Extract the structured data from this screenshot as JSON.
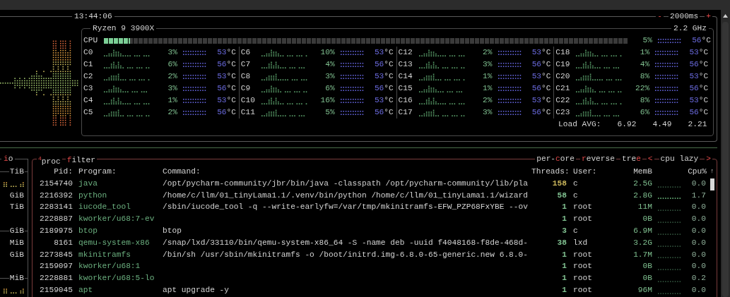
{
  "clock": "13:44:06",
  "interval": {
    "minus": "-",
    "value": "2000ms",
    "plus": "+"
  },
  "cpu": {
    "model": "Ryzen 9 3900X",
    "frequency": "2.2 GHz",
    "total": {
      "label": "CPU",
      "level": 0.05,
      "percent": "5%",
      "temp": "56",
      "temp_unit": "°C"
    },
    "cores": [
      {
        "name": "C0",
        "percent": "3%",
        "temp": "53",
        "temp_unit": "°C"
      },
      {
        "name": "C1",
        "percent": "6%",
        "temp": "56",
        "temp_unit": "°C"
      },
      {
        "name": "C2",
        "percent": "2%",
        "temp": "53",
        "temp_unit": "°C"
      },
      {
        "name": "C3",
        "percent": "3%",
        "temp": "56",
        "temp_unit": "°C"
      },
      {
        "name": "C4",
        "percent": "1%",
        "temp": "53",
        "temp_unit": "°C"
      },
      {
        "name": "C5",
        "percent": "2%",
        "temp": "56",
        "temp_unit": "°C"
      },
      {
        "name": "C6",
        "percent": "10%",
        "temp": "53",
        "temp_unit": "°C"
      },
      {
        "name": "C7",
        "percent": "4%",
        "temp": "56",
        "temp_unit": "°C"
      },
      {
        "name": "C8",
        "percent": "3%",
        "temp": "53",
        "temp_unit": "°C"
      },
      {
        "name": "C9",
        "percent": "6%",
        "temp": "56",
        "temp_unit": "°C"
      },
      {
        "name": "C10",
        "percent": "16%",
        "temp": "53",
        "temp_unit": "°C"
      },
      {
        "name": "C11",
        "percent": "5%",
        "temp": "56",
        "temp_unit": "°C"
      },
      {
        "name": "C12",
        "percent": "2%",
        "temp": "53",
        "temp_unit": "°C"
      },
      {
        "name": "C13",
        "percent": "3%",
        "temp": "56",
        "temp_unit": "°C"
      },
      {
        "name": "C14",
        "percent": "1%",
        "temp": "53",
        "temp_unit": "°C"
      },
      {
        "name": "C15",
        "percent": "1%",
        "temp": "56",
        "temp_unit": "°C"
      },
      {
        "name": "C16",
        "percent": "2%",
        "temp": "53",
        "temp_unit": "°C"
      },
      {
        "name": "C17",
        "percent": "3%",
        "temp": "56",
        "temp_unit": "°C"
      },
      {
        "name": "C18",
        "percent": "1%",
        "temp": "53",
        "temp_unit": "°C"
      },
      {
        "name": "C19",
        "percent": "4%",
        "temp": "56",
        "temp_unit": "°C"
      },
      {
        "name": "C20",
        "percent": "8%",
        "temp": "53",
        "temp_unit": "°C"
      },
      {
        "name": "C21",
        "percent": "22%",
        "temp": "56",
        "temp_unit": "°C"
      },
      {
        "name": "C22",
        "percent": "8%",
        "temp": "53",
        "temp_unit": "°C"
      },
      {
        "name": "C23",
        "percent": "6%",
        "temp": "56",
        "temp_unit": "°C"
      }
    ],
    "load": {
      "label": "Load AVG:",
      "values": [
        "6.92",
        "4.49",
        "2.21"
      ]
    }
  },
  "io_panel": {
    "title": {
      "hotkey": "i",
      "rest": "o"
    },
    "rows": [
      {
        "kind": "divider",
        "label": "TiB"
      },
      {
        "kind": "graph"
      },
      {
        "kind": "label",
        "label": "GiB"
      },
      {
        "kind": "label",
        "label": "TiB"
      },
      {
        "kind": "blank"
      },
      {
        "kind": "divider",
        "label": "GiB"
      },
      {
        "kind": "label",
        "label": "MiB"
      },
      {
        "kind": "label",
        "label": "GiB"
      },
      {
        "kind": "blank"
      },
      {
        "kind": "divider",
        "label": "MiB"
      },
      {
        "kind": "graph"
      }
    ]
  },
  "proc_panel": {
    "title": "$^{4}$proc",
    "filter": {
      "hotkey": "f",
      "rest": "ilter"
    },
    "toggles": [
      {
        "before": "per-",
        "hotkey": "c",
        "after": "ore"
      },
      {
        "hotkey": "r",
        "after": "everse"
      },
      {
        "before": "tre",
        "hotkey": "e"
      }
    ],
    "sort": {
      "prev": "<",
      "label": "cpu lazy",
      "next": ">"
    },
    "columns": {
      "pid": "Pid:",
      "program": "Program:",
      "command": "Command:",
      "threads": "Threads:",
      "user": "User:",
      "memory": "MemB",
      "cpu": "Cpu%"
    },
    "sort_arrow": "↑",
    "rows": [
      {
        "pid": "2154740",
        "program": "java",
        "command": "/opt/pycharm-community/jbr/bin/java -classpath /opt/pycharm-community/lib/pla",
        "threads": "158",
        "color": "#c8b45a",
        "user": "c",
        "memory": "2.5G",
        "cpu": "0.0"
      },
      {
        "pid": "2216392",
        "program": "python",
        "command": "/home/c/llm/01_tinyLama1.1/.venv/bin/python /home/c/llm/01_tinyLama1.1/wizard",
        "threads": "58",
        "color": "#7fbf8f",
        "user": "c",
        "memory": "2.8G",
        "cpu": "1.7"
      },
      {
        "pid": "2283141",
        "program": "iucode_tool",
        "command": "/sbin/iucode_tool -q --write-earlyfw=/var/tmp/mkinitramfs-EFW_PZP68FxYBE --ov",
        "threads": "1",
        "color": "#7fbf8f",
        "user": "root",
        "memory": "11M",
        "cpu": "0.0"
      },
      {
        "pid": "2228887",
        "program": "kworker/u68:7-ev",
        "threads": "1",
        "color": "#7fbf8f",
        "user": "root",
        "memory": "0B",
        "cpu": "0.0"
      },
      {
        "pid": "2189975",
        "program": "btop",
        "command": "btop",
        "threads": "3",
        "color": "#7fbf8f",
        "user": "c",
        "memory": "6.9M",
        "cpu": "0.0"
      },
      {
        "pid": "8161",
        "program": "qemu-system-x86",
        "command": "/snap/lxd/33110/bin/qemu-system-x86_64 -S -name deb -uuid f4048168-f8de-468d-",
        "threads": "38",
        "color": "#7fbf8f",
        "user": "lxd",
        "memory": "3.2G",
        "cpu": "0.0"
      },
      {
        "pid": "2273845",
        "program": "mkinitramfs",
        "command": "/bin/sh /usr/sbin/mkinitramfs -o /boot/initrd.img-6.8.0-65-generic.new 6.8.0-",
        "threads": "1",
        "color": "#7fbf8f",
        "user": "root",
        "memory": "1.7M",
        "cpu": "0.0"
      },
      {
        "pid": "2159097",
        "program": "kworker/u68:1",
        "threads": "1",
        "color": "#7fbf8f",
        "user": "root",
        "memory": "0B",
        "cpu": "0.0"
      },
      {
        "pid": "2228881",
        "program": "kworker/u68:5-lo",
        "threads": "1",
        "color": "#7fbf8f",
        "user": "root",
        "memory": "0B",
        "cpu": "0.2"
      },
      {
        "pid": "2159045",
        "program": "apt",
        "command": "apt upgrade -y",
        "threads": "1",
        "color": "#7fbf8f",
        "user": "root",
        "memory": "96M",
        "cpu": "0.0"
      }
    ]
  }
}
